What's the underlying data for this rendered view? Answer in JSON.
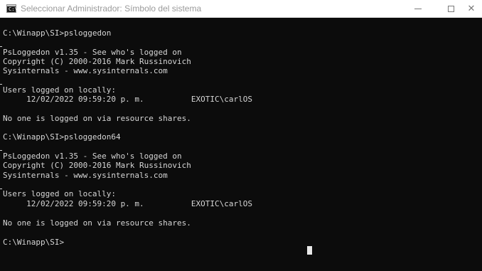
{
  "window": {
    "title": "Seleccionar Administrador: Símbolo del sistema",
    "app_icon_glyph": "C:\\"
  },
  "console": {
    "lines": [
      "C:\\Winapp\\SI>psloggedon",
      "",
      "PsLoggedon v1.35 - See who's logged on",
      "Copyright (C) 2000-2016 Mark Russinovich",
      "Sysinternals - www.sysinternals.com",
      "",
      "Users logged on locally:",
      "     12/02/2022 09:59:20 p. m.          EXOTIC\\carlOS",
      "",
      "No one is logged on via resource shares.",
      "",
      "C:\\Winapp\\SI>psloggedon64",
      "",
      "PsLoggedon v1.35 - See who's logged on",
      "Copyright (C) 2000-2016 Mark Russinovich",
      "Sysinternals - www.sysinternals.com",
      "",
      "Users logged on locally:",
      "     12/02/2022 09:59:20 p. m.          EXOTIC\\carlOS",
      "",
      "No one is logged on via resource shares.",
      "",
      "C:\\Winapp\\SI>"
    ]
  },
  "colors": {
    "console_background": "#0c0c0c",
    "console_text": "#d6d6d6",
    "titlebar_background": "#ffffff",
    "title_text": "#9a9a9a"
  },
  "icons": {
    "app": "cmd-icon",
    "minimize": "minimize-icon",
    "maximize": "maximize-icon",
    "close": "close-icon"
  }
}
